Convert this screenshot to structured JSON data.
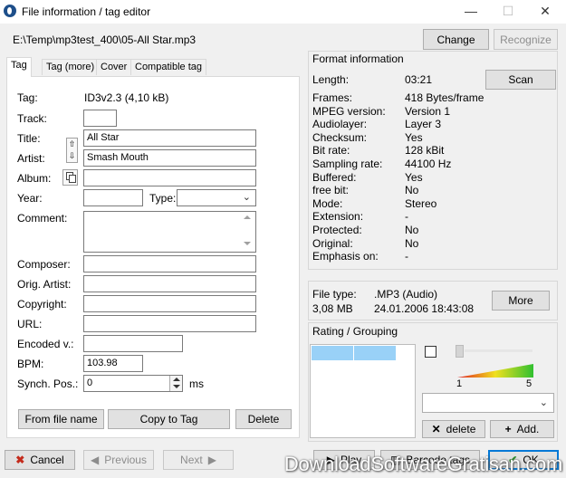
{
  "window": {
    "title": "File information / tag editor",
    "minimize": "—",
    "maximize": "☐",
    "close": "✕"
  },
  "file": {
    "path": "E:\\Temp\\mp3test_400\\05-All Star.mp3",
    "change_label": "Change",
    "recognize_label": "Recognize"
  },
  "tabs": [
    "Tag",
    "Tag (more)",
    "Cover",
    "Compatible tag"
  ],
  "tag": {
    "tag_label": "Tag:",
    "tag_value": "ID3v2.3 (4,10 kB)",
    "track_label": "Track:",
    "track_value": "",
    "title_label": "Title:",
    "title_value": "All Star",
    "artist_label": "Artist:",
    "artist_value": "Smash Mouth",
    "album_label": "Album:",
    "album_value": "",
    "year_label": "Year:",
    "year_value": "",
    "type_label": "Type:",
    "type_value": "",
    "comment_label": "Comment:",
    "comment_value": "",
    "composer_label": "Composer:",
    "composer_value": "",
    "orig_artist_label": "Orig. Artist:",
    "orig_artist_value": "",
    "copyright_label": "Copyright:",
    "copyright_value": "",
    "url_label": "URL:",
    "url_value": "",
    "encoded_label": "Encoded v.:",
    "encoded_value": "",
    "bpm_label": "BPM:",
    "bpm_value": "103.98",
    "synch_label": "Synch. Pos.:",
    "synch_value": "0",
    "synch_unit": "ms",
    "from_file_name_label": "From file name",
    "copy_to_tag_label": "Copy to Tag",
    "delete_label": "Delete"
  },
  "format": {
    "title": "Format information",
    "length_label": "Length:",
    "length_value": "03:21",
    "scan_label": "Scan",
    "rows": [
      {
        "label": "Frames:",
        "value": "418 Bytes/frame"
      },
      {
        "label": "MPEG version:",
        "value": "Version 1"
      },
      {
        "label": "Audiolayer:",
        "value": "Layer 3"
      },
      {
        "label": "Checksum:",
        "value": "Yes"
      },
      {
        "label": "Bit rate:",
        "value": "128 kBit"
      },
      {
        "label": "Sampling rate:",
        "value": "44100 Hz"
      },
      {
        "label": "Buffered:",
        "value": "Yes"
      },
      {
        "label": "free bit:",
        "value": "No"
      },
      {
        "label": "Mode:",
        "value": "Stereo"
      },
      {
        "label": "Extension:",
        "value": "-"
      },
      {
        "label": "Protected:",
        "value": "No"
      },
      {
        "label": "Original:",
        "value": "No"
      },
      {
        "label": "Emphasis on:",
        "value": "-"
      }
    ]
  },
  "fileinfo": {
    "type_label": "File type:",
    "type_value": ".MP3 (Audio)",
    "size_value": "3,08 MB",
    "date_value": "24.01.2006 18:43:08",
    "more_label": "More"
  },
  "rating": {
    "title": "Rating / Grouping",
    "scale_min": "1",
    "scale_max": "5",
    "delete_label": "delete",
    "add_label": "Add."
  },
  "footer": {
    "cancel_label": "Cancel",
    "previous_label": "Previous",
    "next_label": "Next",
    "play_label": "Play",
    "barcode_label": "Barcode tags",
    "ok_label": "OK"
  },
  "watermark": "DownloadSoftwareGratisan.com",
  "colors": {
    "accent_blue": "#99d1f7",
    "cancel_red": "#c42b1c",
    "ok_green": "#2e8b2e"
  }
}
